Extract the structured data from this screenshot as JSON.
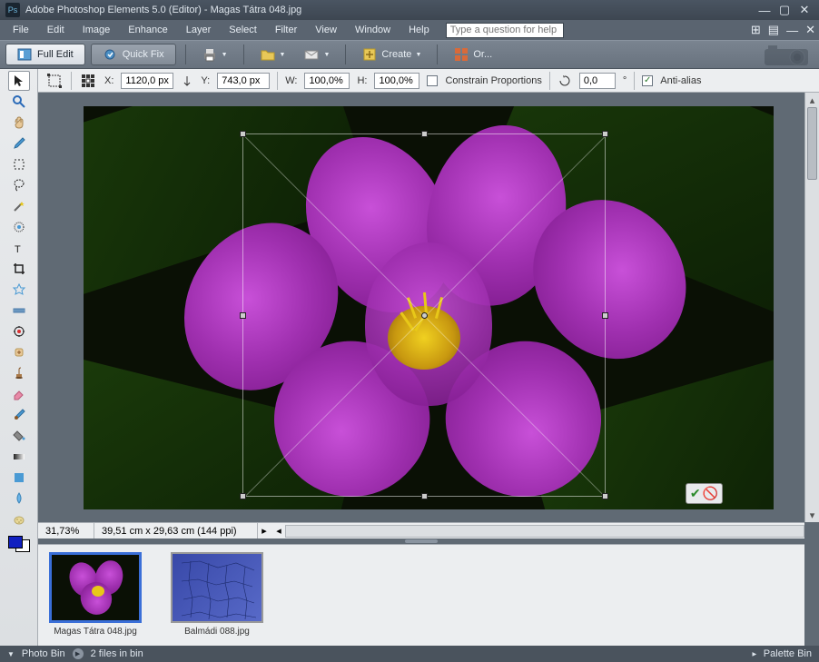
{
  "title": "Adobe Photoshop Elements 5.0 (Editor) - Magas Tátra 048.jpg",
  "menu": {
    "file": "File",
    "edit": "Edit",
    "image": "Image",
    "enhance": "Enhance",
    "layer": "Layer",
    "select": "Select",
    "filter": "Filter",
    "view": "View",
    "window": "Window",
    "help": "Help"
  },
  "help_placeholder": "Type a question for help",
  "mode": {
    "full_edit": "Full Edit",
    "quick_fix": "Quick Fix"
  },
  "toolbar": {
    "create": "Create",
    "organize": "Or..."
  },
  "options": {
    "x_label": "X:",
    "x_value": "1120,0 px",
    "y_label": "Y:",
    "y_value": "743,0 px",
    "w_label": "W:",
    "w_value": "100,0%",
    "h_label": "H:",
    "h_value": "100,0%",
    "constrain": "Constrain Proportions",
    "angle_value": "0,0",
    "angle_unit": "°",
    "antialias": "Anti-alias"
  },
  "info": {
    "zoom": "31,73%",
    "doc_size": "39,51 cm x 29,63 cm (144 ppi)"
  },
  "bin": {
    "files": [
      {
        "name": "Magas Tátra 048.jpg"
      },
      {
        "name": "Balmádi 088.jpg"
      }
    ]
  },
  "status": {
    "photo_bin": "Photo Bin",
    "files_count": "2 files in bin",
    "palette_bin": "Palette Bin"
  },
  "colors": {
    "fg": "#1020c0",
    "bg": "#ffffff"
  }
}
